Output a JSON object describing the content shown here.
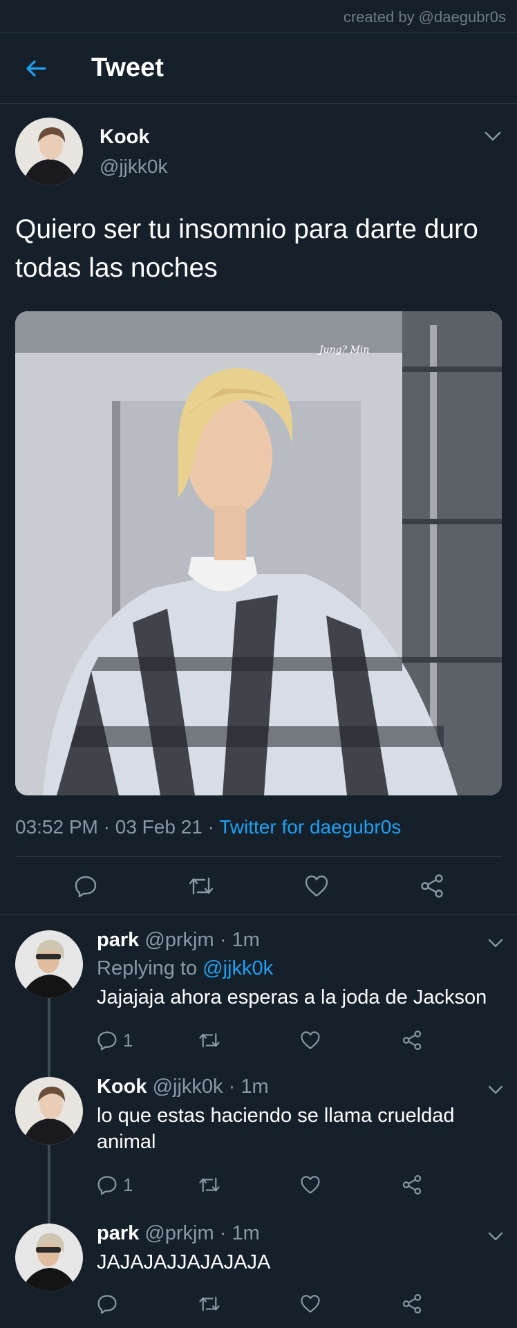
{
  "watermark": "created by @daegubr0s",
  "header": {
    "title": "Tweet"
  },
  "tweet": {
    "author_name": "Kook",
    "author_handle": "@jjkk0k",
    "text": "Quiero ser tu insomnio para darte duro todas las noches",
    "time": "03:52 PM",
    "date": "03 Feb 21",
    "source": "Twitter for daegubr0s",
    "dot": "·",
    "media_watermark": "Jung? Min"
  },
  "replies": [
    {
      "name": "park",
      "handle": "@prkjm",
      "age": "1m",
      "replying_label": "Replying to",
      "replying_to": "@jjkk0k",
      "text": "Jajajaja ahora esperas a la joda de Jackson",
      "reply_count": "1"
    },
    {
      "name": "Kook",
      "handle": "@jjkk0k",
      "age": "1m",
      "text": "lo que estas haciendo se llama crueldad animal",
      "reply_count": "1"
    },
    {
      "name": "park",
      "handle": "@prkjm",
      "age": "1m",
      "text": "JAJAJAJJAJAJAJA",
      "reply_count": ""
    }
  ],
  "colors": {
    "background": "#15202b",
    "accent": "#1da1f2",
    "muted": "#8899a6",
    "divider": "#2a3642"
  },
  "icons": [
    "back-arrow-icon",
    "chevron-down-icon",
    "reply-icon",
    "retweet-icon",
    "like-icon",
    "share-icon"
  ]
}
